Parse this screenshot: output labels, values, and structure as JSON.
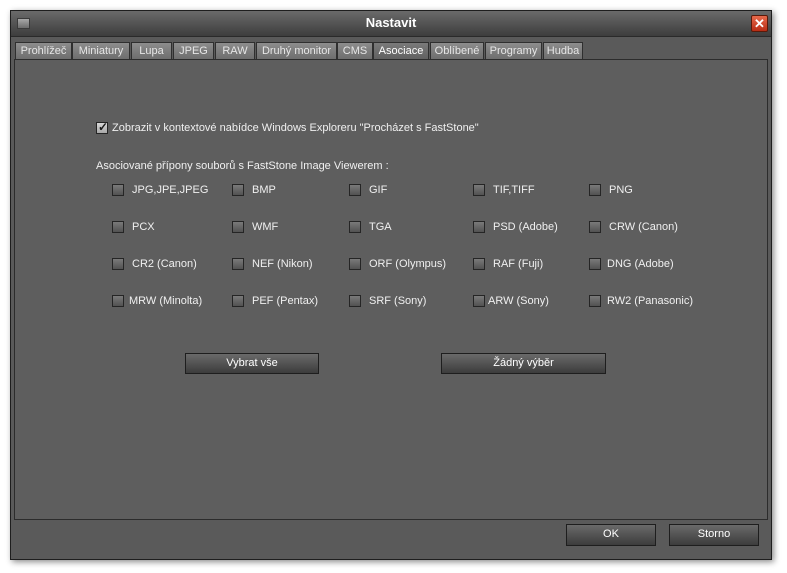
{
  "window": {
    "title": "Nastavit"
  },
  "tabs": [
    {
      "label": "Prohlížeč"
    },
    {
      "label": "Miniatury"
    },
    {
      "label": "Lupa"
    },
    {
      "label": "JPEG"
    },
    {
      "label": "RAW"
    },
    {
      "label": "Druhý monitor"
    },
    {
      "label": "CMS"
    },
    {
      "label": "Asociace"
    },
    {
      "label": "Oblíbené"
    },
    {
      "label": "Programy"
    },
    {
      "label": "Hudba"
    }
  ],
  "active_tab": "Asociace",
  "context_menu_option": {
    "label": "Zobrazit v kontextové nabídce Windows Exploreru \"Procházet s FastStone\"",
    "checked": true
  },
  "extensions_heading": "Asociované přípony souborů s FastStone Image Viewerem :",
  "extensions": [
    {
      "label": "JPG,JPE,JPEG",
      "checked": false
    },
    {
      "label": "BMP",
      "checked": false
    },
    {
      "label": "GIF",
      "checked": false
    },
    {
      "label": "TIF,TIFF",
      "checked": false
    },
    {
      "label": "PNG",
      "checked": false
    },
    {
      "label": "PCX",
      "checked": false
    },
    {
      "label": "WMF",
      "checked": false
    },
    {
      "label": "TGA",
      "checked": false
    },
    {
      "label": "PSD (Adobe)",
      "checked": false
    },
    {
      "label": "CRW (Canon)",
      "checked": false
    },
    {
      "label": "CR2 (Canon)",
      "checked": false
    },
    {
      "label": "NEF (Nikon)",
      "checked": false
    },
    {
      "label": "ORF (Olympus)",
      "checked": false
    },
    {
      "label": "RAF (Fuji)",
      "checked": false
    },
    {
      "label": "DNG (Adobe)",
      "checked": false
    },
    {
      "label": "MRW (Minolta)",
      "checked": false
    },
    {
      "label": "PEF (Pentax)",
      "checked": false
    },
    {
      "label": "SRF (Sony)",
      "checked": false
    },
    {
      "label": "ARW (Sony)",
      "checked": false
    },
    {
      "label": "RW2 (Panasonic)",
      "checked": false
    }
  ],
  "buttons": {
    "select_all": "Vybrat vše",
    "select_none": "Žádný výběr",
    "ok": "OK",
    "cancel": "Storno"
  }
}
